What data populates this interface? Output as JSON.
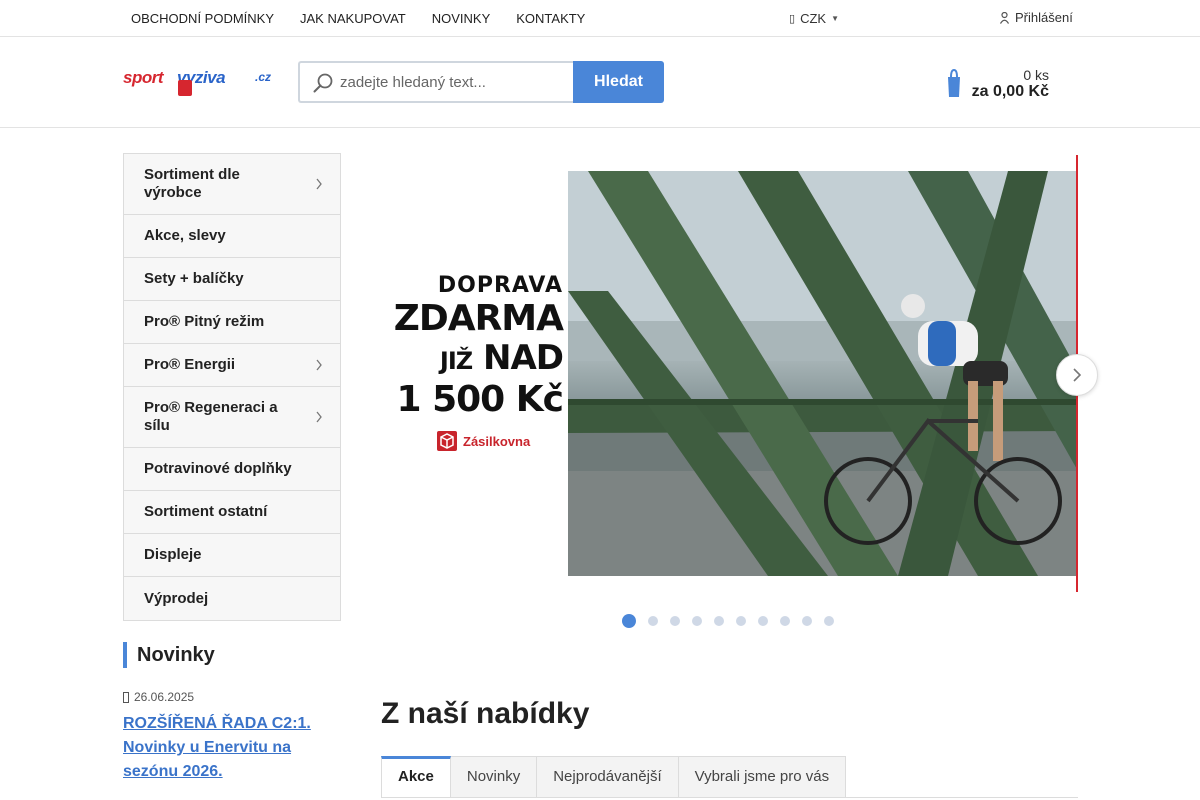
{
  "topbar": {
    "nav": [
      "OBCHODNÍ PODMÍNKY",
      "JAK NAKUPOVAT",
      "NOVINKY",
      "KONTAKTY"
    ],
    "currency": "CZK",
    "login": "Přihlášení"
  },
  "header": {
    "logo": {
      "part1": "sport",
      "part2": "vyziva",
      "part3": ".cz"
    },
    "search_placeholder": "zadejte hledaný text...",
    "search_button": "Hledat",
    "cart": {
      "qty": "0 ks",
      "total": "za 0,00 Kč"
    }
  },
  "sidebar": {
    "items": [
      {
        "label": "Sortiment dle výrobce",
        "has_sub": true
      },
      {
        "label": "Akce, slevy",
        "has_sub": false
      },
      {
        "label": "Sety + balíčky",
        "has_sub": false
      },
      {
        "label": "Pro® Pitný režim",
        "has_sub": false
      },
      {
        "label": "Pro® Energii",
        "has_sub": true
      },
      {
        "label": "Pro® Regeneraci a sílu",
        "has_sub": true
      },
      {
        "label": "Potravinové doplňky",
        "has_sub": false
      },
      {
        "label": "Sortiment ostatní",
        "has_sub": false
      },
      {
        "label": "Displeje",
        "has_sub": false
      },
      {
        "label": "Výprodej",
        "has_sub": false
      }
    ]
  },
  "news": {
    "heading": "Novinky",
    "date": "26.06.2025",
    "link": "ROZŠÍŘENÁ ŘADA C2:1. Novinky u Enervitu na sezónu 2026."
  },
  "banner": {
    "line1": "DOPRAVA",
    "line2": "ZDARMA",
    "line3_small": "JIŽ",
    "line3_big": "NAD",
    "line4": "1 500 Kč",
    "brand": "Zásilkovna",
    "slides_total": 10,
    "active_slide": 1
  },
  "offer": {
    "title": "Z naší nabídky",
    "tabs": [
      "Akce",
      "Novinky",
      "Nejprodávanější",
      "Vybrali jsme pro vás"
    ],
    "active_tab": 0
  },
  "colors": {
    "accent": "#4a86d8",
    "brand_red": "#d6262f"
  }
}
